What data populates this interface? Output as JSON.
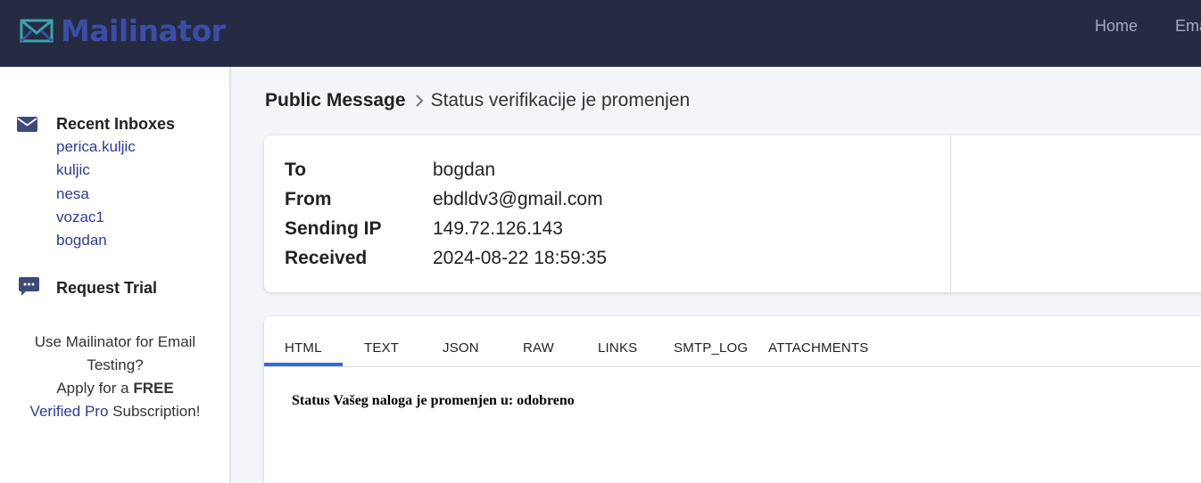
{
  "header": {
    "logo_text": "Mailinator",
    "nav": {
      "home": "Home",
      "email": "Ema"
    }
  },
  "sidebar": {
    "recent_heading": "Recent Inboxes",
    "inboxes": [
      "perica.kuljic",
      "kuljic",
      "nesa",
      "vozac1",
      "bogdan"
    ],
    "trial_heading": "Request Trial",
    "promo": {
      "line1": "Use Mailinator for Email Testing?",
      "apply": "Apply for a ",
      "free": "FREE",
      "verified_pro": "Verified Pro",
      "subscription": " Subscription!"
    }
  },
  "breadcrumb": {
    "root": "Public Message",
    "current": "Status verifikacije je promenjen"
  },
  "message": {
    "to_label": "To",
    "to": "bogdan",
    "from_label": "From",
    "from": "ebdldv3@gmail.com",
    "ip_label": "Sending IP",
    "ip": "149.72.126.143",
    "received_label": "Received",
    "received": "2024-08-22 18:59:35",
    "body": "Status Vašeg naloga je promenjen u: odobreno"
  },
  "tabs": [
    "HTML",
    "TEXT",
    "JSON",
    "RAW",
    "LINKS",
    "SMTP_LOG",
    "ATTACHMENTS"
  ],
  "active_tab": "HTML",
  "colors": {
    "topbar": "#252b43",
    "brand": "#3b4ea6",
    "link": "#2d3a9a",
    "tab_active": "#2c6fd6"
  },
  "icons": {
    "logo": "envelope-logo-icon",
    "recent": "mail-icon",
    "trial": "chat-bubble-icon"
  }
}
